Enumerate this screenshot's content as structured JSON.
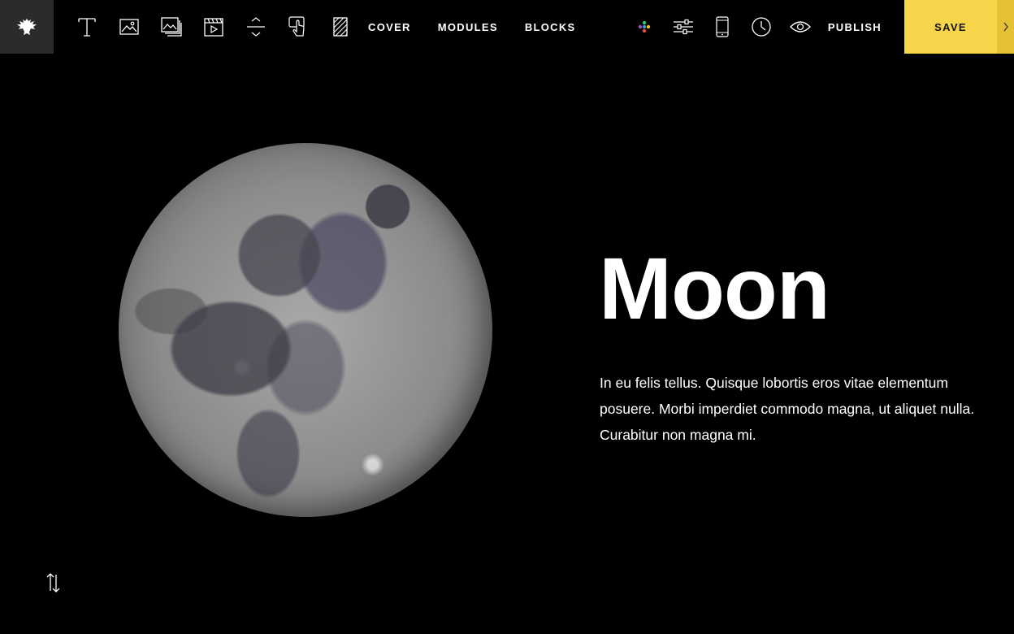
{
  "toolbar": {
    "logo_icon": "eagle-logo-icon",
    "tools": [
      {
        "name": "text-tool",
        "icon": "text-icon"
      },
      {
        "name": "image-tool",
        "icon": "image-icon"
      },
      {
        "name": "gallery-tool",
        "icon": "gallery-icon"
      },
      {
        "name": "video-tool",
        "icon": "video-icon"
      },
      {
        "name": "spacer-tool",
        "icon": "spacer-icon"
      },
      {
        "name": "button-tool",
        "icon": "hand-pointer-icon"
      },
      {
        "name": "pattern-tool",
        "icon": "hatch-icon"
      }
    ],
    "nav": {
      "cover": "COVER",
      "modules": "MODULES",
      "blocks": "BLOCKS"
    },
    "right_icons": [
      "color-dots-icon",
      "sliders-icon",
      "mobile-icon",
      "clock-icon",
      "eye-icon"
    ],
    "publish_label": "PUBLISH",
    "save_label": "SAVE"
  },
  "content": {
    "title": "Moon",
    "body": "In eu felis tellus. Quisque lobortis eros vitae elementum posuere. Morbi imperdiet commodo magna, ut aliquet nulla. Curabitur non magna mi."
  },
  "colors": {
    "background": "#000000",
    "save_yellow": "#f7d54a",
    "logo_bg": "#2b2b2b"
  }
}
